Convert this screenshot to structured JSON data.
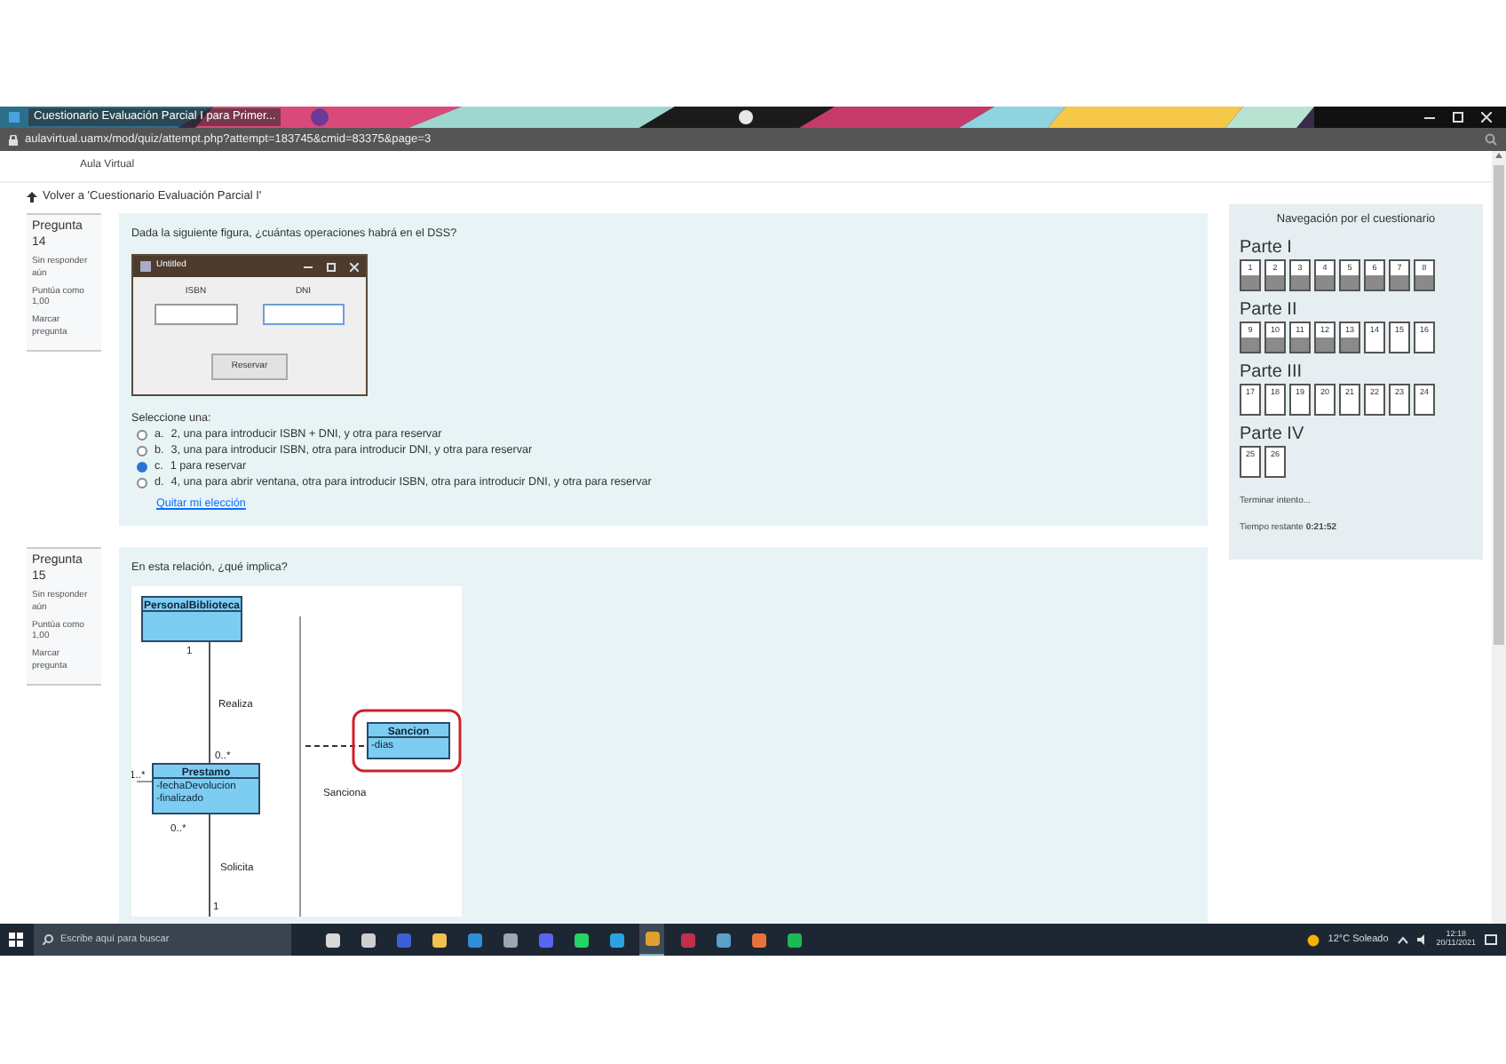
{
  "browser": {
    "tab_title": "Cuestionario Evaluación Parcial I para Primer...",
    "url": "aulavirtual.uamx/mod/quiz/attempt.php?attempt=183745&cmid=83375&page=3"
  },
  "site": {
    "brand": "Aula Virtual",
    "back_link": "Volver a 'Cuestionario Evaluación Parcial I'"
  },
  "questions": [
    {
      "number": "Pregunta 14",
      "status": "Sin responder aún",
      "score": "Puntúa como 1,00",
      "flag": "Marcar pregunta",
      "kind": "choice",
      "text": "Dada la siguiente figura, ¿cuántas operaciones habrá en el DSS?",
      "dialog": {
        "title": "Untitled",
        "fields": [
          "ISBN",
          "DNI"
        ],
        "button": "Reservar"
      },
      "prompt": "Seleccione una:",
      "options": [
        {
          "letter": "a.",
          "text": "2, una para introducir ISBN + DNI, y otra para reservar",
          "selected": false
        },
        {
          "letter": "b.",
          "text": "3, una para introducir ISBN, otra para introducir DNI, y otra para reservar",
          "selected": false
        },
        {
          "letter": "c.",
          "text": "1 para reservar",
          "selected": true
        },
        {
          "letter": "d.",
          "text": "4, una para abrir ventana, otra para introducir ISBN, otra para introducir DNI, y otra para reservar",
          "selected": false
        }
      ],
      "clear": "Quitar mi elección"
    },
    {
      "number": "Pregunta 15",
      "status": "Sin responder aún",
      "score": "Puntúa como 1,00",
      "flag": "Marcar pregunta",
      "kind": "diagram",
      "text": "En esta relación, ¿qué implica?",
      "diagram": {
        "classes": [
          {
            "name": "PersonalBiblioteca",
            "highlighted": false
          },
          {
            "name": "Prestamo",
            "attributes": [
              "-fechaDevolucion",
              "-finalizado"
            ],
            "highlighted": false
          },
          {
            "name": "Sancion",
            "attributes": [
              "-dias"
            ],
            "highlighted": true
          }
        ],
        "labels": [
          "1",
          "Realiza",
          "0..*",
          "1..*",
          "0..*",
          "Solicita",
          "Sanciona",
          "1"
        ]
      }
    }
  ],
  "navigation": {
    "title": "Navegación por el cuestionario",
    "parts": [
      {
        "title": "Parte I",
        "questions": [
          {
            "label": "1",
            "answered": true
          },
          {
            "label": "2",
            "answered": true
          },
          {
            "label": "3",
            "answered": true
          },
          {
            "label": "4",
            "answered": true
          },
          {
            "label": "5",
            "answered": true
          },
          {
            "label": "6",
            "answered": true
          },
          {
            "label": "7",
            "answered": true
          },
          {
            "label": "8",
            "answered": true
          }
        ]
      },
      {
        "title": "Parte II",
        "questions": [
          {
            "label": "9",
            "answered": true
          },
          {
            "label": "10",
            "answered": true
          },
          {
            "label": "11",
            "answered": true
          },
          {
            "label": "12",
            "answered": true
          },
          {
            "label": "13",
            "answered": true
          },
          {
            "label": "14",
            "answered": false
          },
          {
            "label": "15",
            "answered": false
          },
          {
            "label": "16",
            "answered": false
          }
        ]
      },
      {
        "title": "Parte III",
        "questions": [
          {
            "label": "17",
            "answered": false
          },
          {
            "label": "18",
            "answered": false
          },
          {
            "label": "19",
            "answered": false
          },
          {
            "label": "20",
            "answered": false
          },
          {
            "label": "21",
            "answered": false
          },
          {
            "label": "22",
            "answered": false
          },
          {
            "label": "23",
            "answered": false
          },
          {
            "label": "24",
            "answered": false
          }
        ]
      },
      {
        "title": "Parte IV",
        "questions": [
          {
            "label": "25",
            "answered": false
          },
          {
            "label": "26",
            "answered": false
          }
        ]
      }
    ],
    "finish": "Terminar intento...",
    "time_label": "Tiempo restante",
    "time": "0:21:52"
  },
  "taskbar": {
    "search_placeholder": "Escribe aquí para buscar",
    "apps": [
      {
        "color": "#d8d8d8",
        "selected": false
      },
      {
        "color": "#cfcfcf",
        "selected": false
      },
      {
        "color": "#3b5fd6",
        "selected": false
      },
      {
        "color": "#f2c14e",
        "selected": false
      },
      {
        "color": "#2f8fd6",
        "selected": false
      },
      {
        "color": "#9aa8b4",
        "selected": false
      },
      {
        "color": "#5865f2",
        "selected": false
      },
      {
        "color": "#25d366",
        "selected": false
      },
      {
        "color": "#2aa3e0",
        "selected": false
      },
      {
        "color": "#e0a030",
        "selected": true
      },
      {
        "color": "#c0304a",
        "selected": false
      },
      {
        "color": "#5aa0c8",
        "selected": false
      },
      {
        "color": "#e8733a",
        "selected": false
      },
      {
        "color": "#1db954",
        "selected": false
      }
    ],
    "weather": "12°C Soleado",
    "time": "12:18",
    "date": "20/11/2021"
  }
}
